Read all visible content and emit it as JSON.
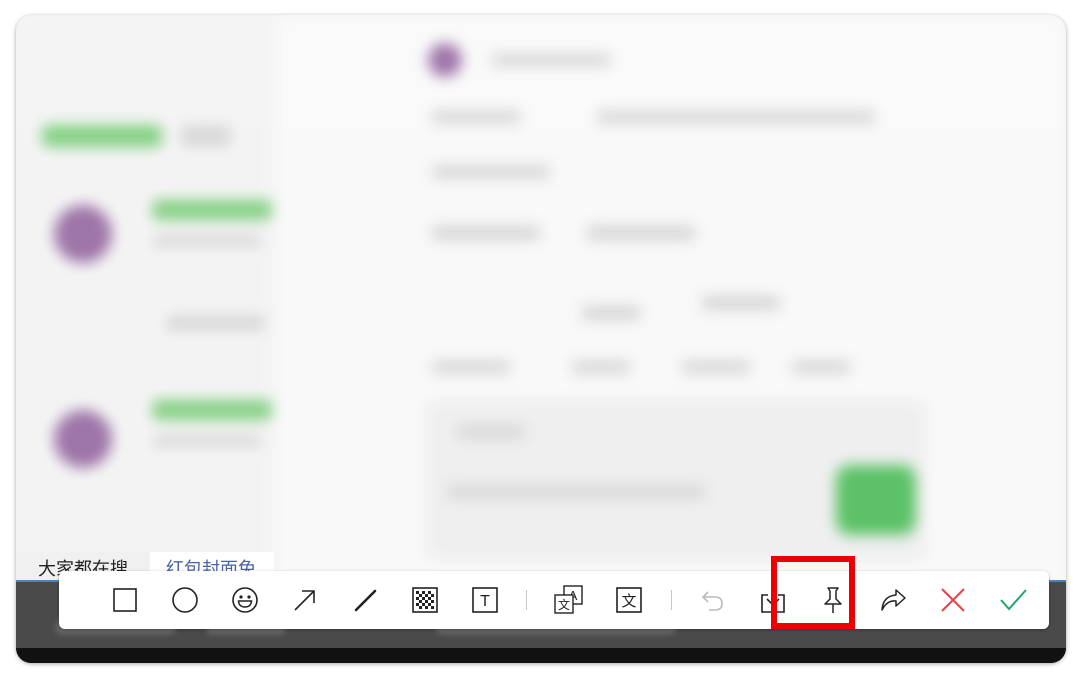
{
  "background_tabs": {
    "tab_trending": "大家都在搜",
    "tab_red_envelope": "红包封面免"
  },
  "toolbar": {
    "tools": [
      {
        "id": "rectangle",
        "icon": "rectangle-icon"
      },
      {
        "id": "ellipse",
        "icon": "ellipse-icon"
      },
      {
        "id": "emoji",
        "icon": "emoji-icon"
      },
      {
        "id": "arrow",
        "icon": "arrow-icon"
      },
      {
        "id": "pen",
        "icon": "pen-icon"
      },
      {
        "id": "mosaic",
        "icon": "mosaic-icon"
      },
      {
        "id": "text",
        "icon": "text-icon",
        "glyph": "T"
      },
      {
        "id": "translate",
        "icon": "translate-icon",
        "glyph_a": "A",
        "glyph_b": "文"
      },
      {
        "id": "extract-text",
        "icon": "extract-text-icon",
        "glyph": "文"
      },
      {
        "id": "undo",
        "icon": "undo-icon"
      },
      {
        "id": "save",
        "icon": "download-icon"
      },
      {
        "id": "pin",
        "icon": "pin-icon",
        "highlighted": true
      },
      {
        "id": "share",
        "icon": "share-icon"
      },
      {
        "id": "cancel",
        "icon": "close-icon"
      },
      {
        "id": "confirm",
        "icon": "check-icon"
      }
    ]
  },
  "colors": {
    "highlight": "#ee0000",
    "cancel": "#e8424a",
    "confirm": "#21a66a",
    "selection": "#4f81c7"
  }
}
